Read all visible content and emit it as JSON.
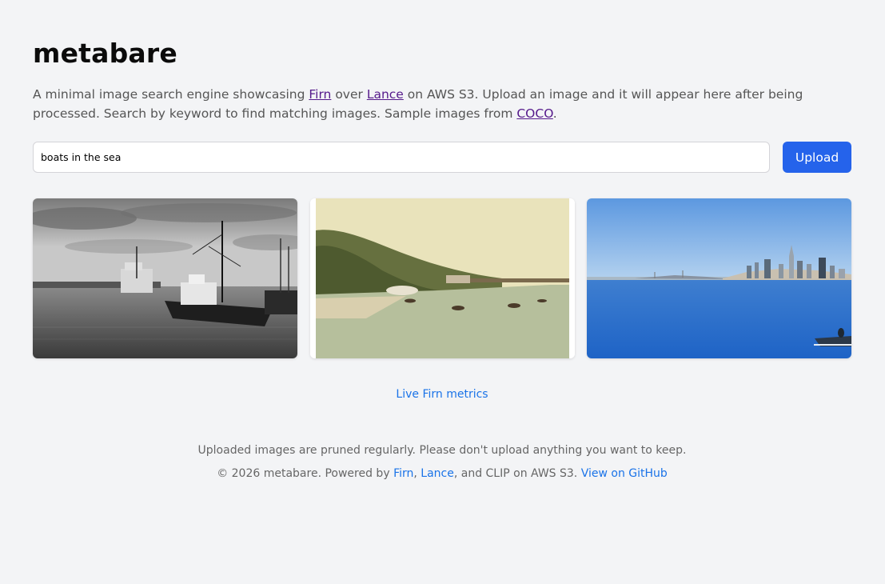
{
  "header": {
    "title": "metabare"
  },
  "intro": {
    "part1": "A minimal image search engine showcasing ",
    "link_firn": "Firn",
    "part2": " over ",
    "link_lance": "Lance",
    "part3": " on AWS S3. Upload an image and it will appear here after being processed. Search by keyword to find matching images. Sample images from ",
    "link_coco": "COCO",
    "part4": "."
  },
  "search": {
    "value": "boats in the sea",
    "placeholder": ""
  },
  "upload": {
    "label": "Upload"
  },
  "results": [
    {
      "id": "result-harbor-bw"
    },
    {
      "id": "result-vintage-river"
    },
    {
      "id": "result-bay-skyline"
    }
  ],
  "metrics": {
    "link_label": "Live Firn metrics"
  },
  "footer": {
    "notice": "Uploaded images are pruned regularly. Please don't upload anything you want to keep.",
    "copyright": "© 2026 metabare. Powered by ",
    "link_firn": "Firn",
    "sep1": ", ",
    "link_lance": "Lance",
    "sep2": ", and CLIP on AWS S3. ",
    "link_github": "View on GitHub"
  },
  "colors": {
    "accent": "#2563eb",
    "link": "#1a73e8",
    "visited_link": "#551a8b",
    "background": "#f3f4f6"
  }
}
